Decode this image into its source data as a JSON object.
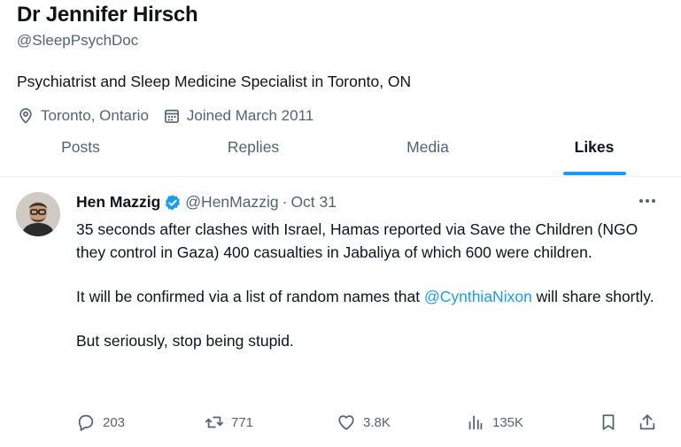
{
  "profile": {
    "name": "Dr Jennifer Hirsch",
    "handle": "@SleepPsychDoc",
    "bio": "Psychiatrist and Sleep Medicine Specialist in Toronto, ON",
    "location": "Toronto, Ontario",
    "joined": "Joined March 2011",
    "location_icon": "location-pin-icon",
    "joined_icon": "calendar-icon"
  },
  "tabs": [
    {
      "label": "Posts",
      "active": false
    },
    {
      "label": "Replies",
      "active": false
    },
    {
      "label": "Media",
      "active": false
    },
    {
      "label": "Likes",
      "active": true
    }
  ],
  "tweet": {
    "author_name": "Hen Mazzig",
    "author_handle": "@HenMazzig",
    "separator": "·",
    "date": "Oct 31",
    "verified": true,
    "para1": "35 seconds after clashes with Israel, Hamas reported via Save the Children (NGO they control in Gaza) 400 casualties in Jabaliya of which 600 were children.",
    "para2_before": "It will be confirmed via a list of random names that ",
    "para2_mention": "@CynthiaNixon",
    "para2_after": " will share shortly.",
    "para3": "But seriously, stop being stupid.",
    "replies": "203",
    "reposts": "771",
    "likes": "3.8K",
    "views": "135K"
  },
  "colors": {
    "accent": "#1d9bf0",
    "text_primary": "#0f1419",
    "text_secondary": "#536471",
    "divider": "#eff3f4"
  }
}
